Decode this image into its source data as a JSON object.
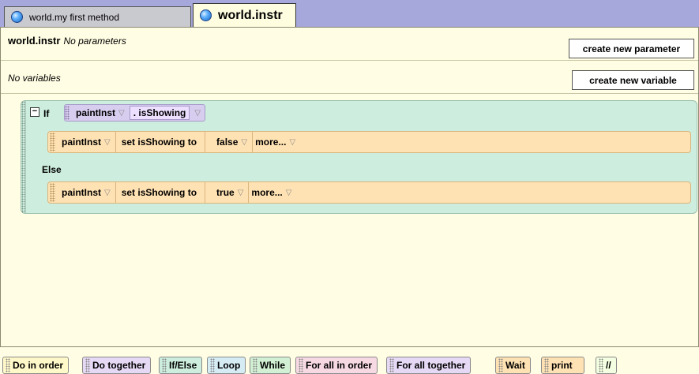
{
  "tabs": [
    {
      "label": "world.my first method",
      "active": false
    },
    {
      "label": "world.instr",
      "active": true
    }
  ],
  "method": {
    "name": "world.instr",
    "params_text": "No parameters",
    "vars_text": "No variables",
    "create_param_label": "create new parameter",
    "create_var_label": "create new variable"
  },
  "if_block": {
    "if_label": "If",
    "collapse_symbol": "−",
    "condition_object": "paintInst",
    "condition_property": ". isShowing",
    "else_label": "Else",
    "then_stmt": {
      "object": "paintInst",
      "action": "set isShowing to",
      "value": "false",
      "more": "more..."
    },
    "else_stmt": {
      "object": "paintInst",
      "action": "set isShowing to",
      "value": "true",
      "more": "more..."
    }
  },
  "palette": [
    {
      "label": "Do in order",
      "color": "#fff8c8"
    },
    {
      "label": "Do together",
      "color": "#e6d9f5"
    },
    {
      "label": "If/Else",
      "color": "#cdeede"
    },
    {
      "label": "Loop",
      "color": "#d6ecf5"
    },
    {
      "label": "While",
      "color": "#d2f0d4"
    },
    {
      "label": "For all in order",
      "color": "#f6d9e2"
    },
    {
      "label": "For all together",
      "color": "#e6d9f5"
    },
    {
      "label": "Wait",
      "color": "#ffe2b3"
    },
    {
      "label": "print",
      "color": "#ffe2b3"
    },
    {
      "label": "//",
      "color": "#f3ffe0"
    }
  ]
}
